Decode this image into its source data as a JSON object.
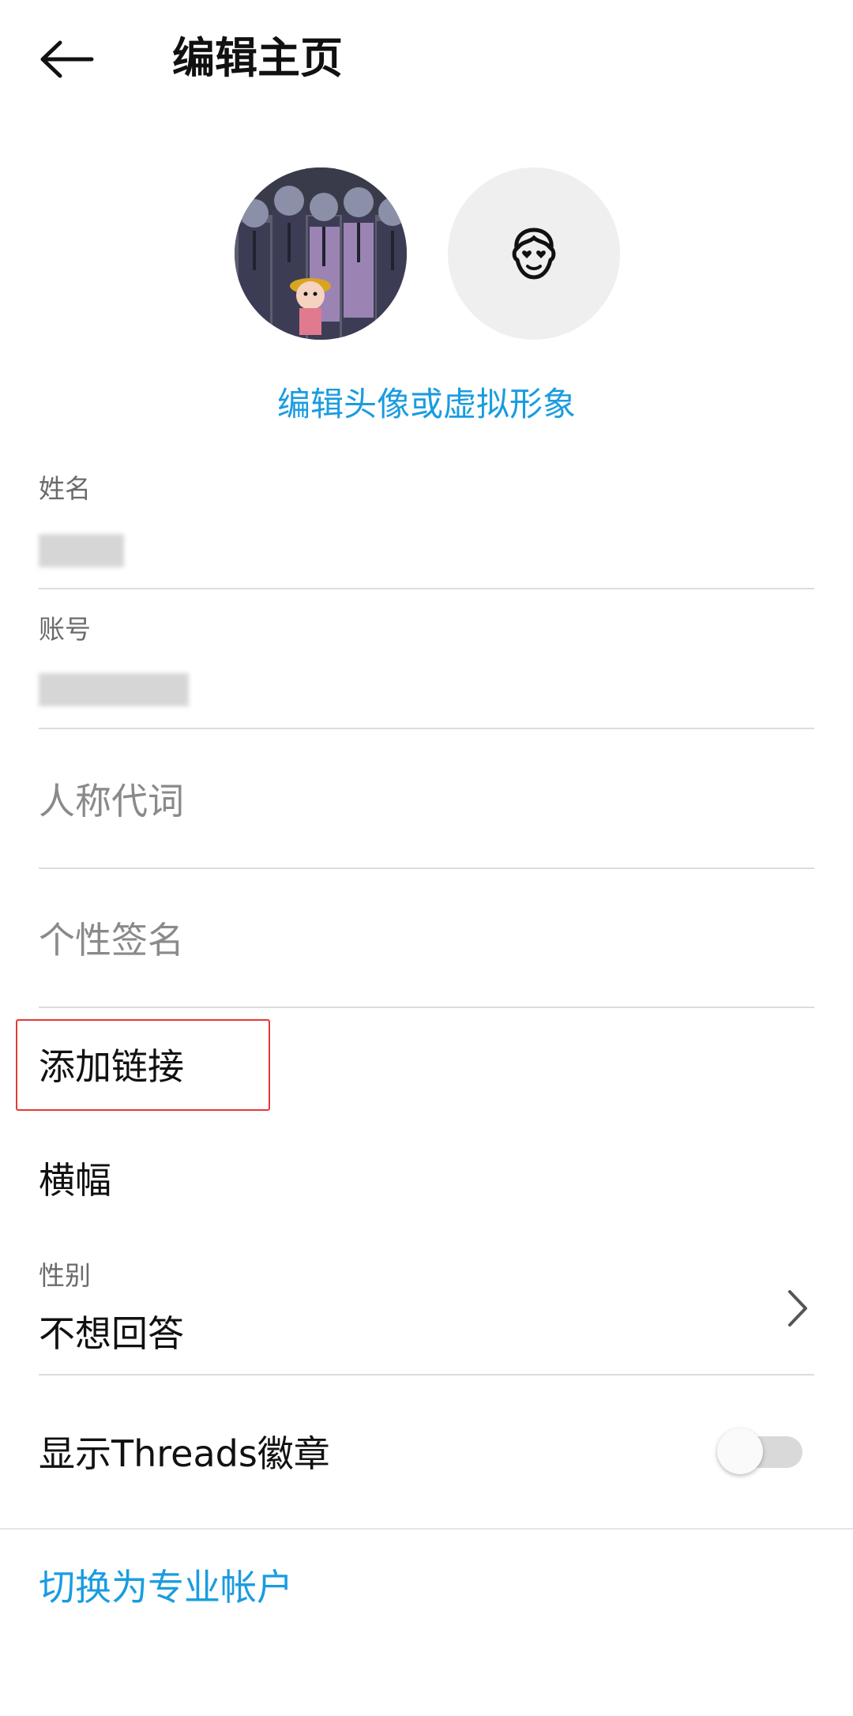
{
  "header": {
    "back_icon": "arrow-left-icon",
    "title": "编辑主页"
  },
  "avatar": {
    "photo_icon": "profile-photo",
    "virtual_icon": "avatar-face-icon",
    "edit_link": "编辑头像或虚拟形象"
  },
  "fields": {
    "name_label": "姓名",
    "account_label": "账号",
    "pronouns_placeholder": "人称代词",
    "bio_placeholder": "个性签名"
  },
  "rows": {
    "add_link": "添加链接",
    "banner": "横幅",
    "gender_label": "性别",
    "gender_value": "不想回答",
    "threads_badge": "显示Threads徽章",
    "threads_badge_enabled": false
  },
  "footer": {
    "switch_pro": "切换为专业帐户"
  },
  "colors": {
    "accent": "#1a9ce0",
    "highlight": "#e53935"
  }
}
